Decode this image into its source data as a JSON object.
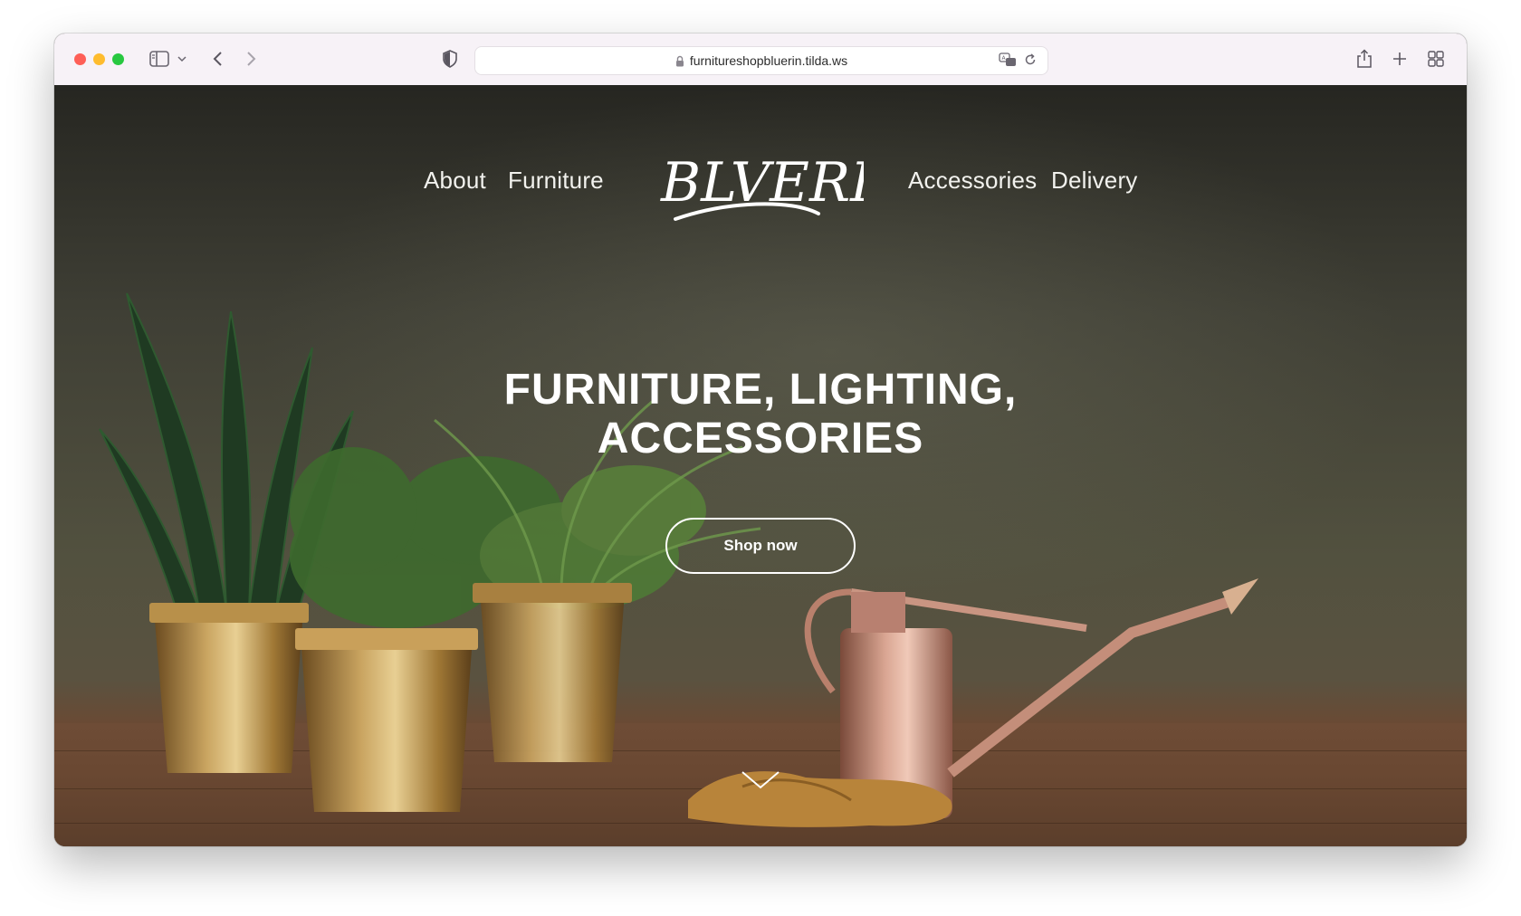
{
  "browser": {
    "url": "furnitureshopbluerin.tilda.ws",
    "icons": [
      "sidebar-icon",
      "chevron-down-icon",
      "back-icon",
      "forward-icon",
      "privacy-shield-icon",
      "lock-icon",
      "translate-icon",
      "reload-icon",
      "share-icon",
      "new-tab-icon",
      "tab-overview-icon"
    ]
  },
  "site": {
    "brand": "BLVERIN",
    "nav": {
      "about": "About",
      "furniture": "Furniture",
      "accessories": "Accessories",
      "delivery": "Delivery"
    },
    "hero": {
      "headline_line1": "FURNITURE, LIGHTING,",
      "headline_line2": "ACCESSORIES",
      "cta": "Shop now"
    }
  },
  "colors": {
    "traffic_red": "#fe5f57",
    "traffic_yellow": "#febc2e",
    "traffic_green": "#28c840",
    "hero_text": "#ffffff"
  }
}
